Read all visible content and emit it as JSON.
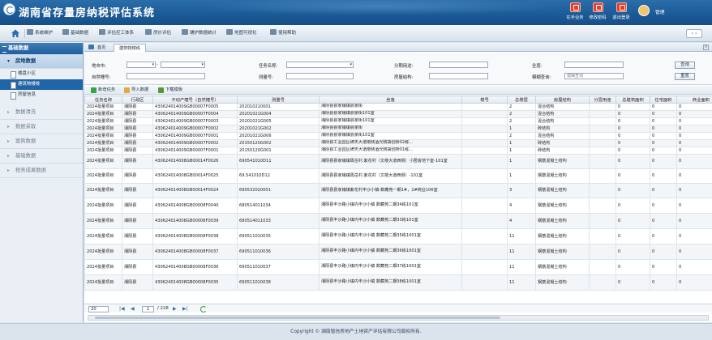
{
  "app": {
    "title": "湖南省存量房纳税评估系统"
  },
  "header": {
    "buttons": [
      {
        "label": "在手业务"
      },
      {
        "label": "修改密码"
      },
      {
        "label": "退出登录"
      }
    ],
    "username": "管理"
  },
  "nav": {
    "items": [
      {
        "label": "系统维护"
      },
      {
        "label": "基础数据"
      },
      {
        "label": "评估控工体系"
      },
      {
        "label": "房价评估"
      },
      {
        "label": "辅护数据统计"
      },
      {
        "label": "地图可视化"
      },
      {
        "label": "使用帮助"
      }
    ],
    "arrows": "‹ ›"
  },
  "sidebar": {
    "title": "基础数据",
    "sections": [
      {
        "label": "房地数据",
        "active": true,
        "items": [
          {
            "label": "楼盘小区"
          },
          {
            "label": "建筑物楼栋",
            "selected": true
          },
          {
            "label": "房屋信息"
          }
        ]
      },
      {
        "label": "数据清洗"
      },
      {
        "label": "数据采取"
      },
      {
        "label": "案例数据"
      },
      {
        "label": "基础数据"
      },
      {
        "label": "税务成果数据"
      }
    ]
  },
  "tabs": [
    {
      "label": "首页"
    },
    {
      "label": "建筑物楼栋"
    }
  ],
  "tab_close": "×",
  "search": {
    "labels": {
      "region": "地市市:",
      "dash": "-",
      "name": "任务名称:",
      "pattern": "分期用途:",
      "floor": "全层:",
      "natural_no": "自然幢号:",
      "survey_no": "测量号:",
      "structure": "房屋结构:",
      "fuzzy": "模糊查询:"
    },
    "fuzzy_placeholder": "模糊查询",
    "query_btn": "查询",
    "reset_btn": "重置"
  },
  "toolbar": {
    "add": "新增任务",
    "import": "导入数据",
    "download": "下载模板"
  },
  "table": {
    "headers": [
      "任务名称",
      "行政区",
      "不动产幢号（自然幢号）",
      "测量号",
      "坐落",
      "楼号",
      "总楼层",
      "房屋结构",
      "分层用途",
      "总建筑面积",
      "住宅面积",
      "商业面积"
    ],
    "rows": [
      [
        "2024批量项目",
        "湘阴县",
        "430624014009GB00007F0005",
        "202010210001",
        "湘阴县县家铺镇县家街",
        "",
        "2",
        "混合结构",
        "",
        "0",
        "0",
        "0"
      ],
      [
        "2024批量项目",
        "湘阴县",
        "430624014009GB00007F0004",
        "20201021G004",
        "湘阴县县家铺镇县家街101室",
        "",
        "2",
        "混合结构",
        "",
        "0",
        "0",
        "0"
      ],
      [
        "2024批量项目",
        "湘阴县",
        "430624014009GB00007F0003",
        "20201021G005",
        "湘阴县县家铺镇县家街101室",
        "",
        "2",
        "混合结构",
        "",
        "0",
        "0",
        "0"
      ],
      [
        "2024批量项目",
        "湘阴县",
        "430624014009GB00007F0002",
        "20201021G002",
        "湘阴县县家铺镇县家街",
        "",
        "1",
        "砖结构",
        "",
        "0",
        "0",
        "0"
      ],
      [
        "2024批量项目",
        "湘阴县",
        "430624014009GB00007F0001",
        "20201021G006",
        "湘阴县县家铺镇县家街101室",
        "",
        "2",
        "混合结构",
        "",
        "0",
        "0",
        "0"
      ],
      [
        "2024批量项目",
        "湘阴县",
        "430624014009GB00007F0002",
        "20150120G002",
        "湘阴县工业园区碑天大道南侧酒光锈袋创桥02栋...",
        "",
        "1",
        "砖结构",
        "",
        "0",
        "0",
        "0"
      ],
      [
        "2024批量项目",
        "湘阴县",
        "430624014009GB00007F0001",
        "20150120G001",
        "湘阴县工业园区碑天大道南侧酒光锈袋创桥01栋...",
        "",
        "1",
        "砖结构",
        "",
        "0",
        "0",
        "0"
      ],
      [
        "2024批量项目",
        "湘阴县",
        "430624014008GB00014F0026",
        "690541010D11",
        "湘阴县县家铺镇周岳村.紫花村（文楼大道西侧）小居房地下室-101室",
        "",
        "1",
        "钢筋混凝土结构",
        "",
        "0",
        "0",
        "0"
      ],
      [
        "2024批量项目",
        "湘阴县",
        "430624014008GB00014F0025",
        "69.541010D12",
        "湘阴县县家铺镇周岳村.紫花村（文楼大道西侧）-101室",
        "",
        "1",
        "钢筋混凝土结构",
        "",
        "0",
        "0",
        "0"
      ],
      [
        "2024批量项目",
        "湘阴县",
        "430624014008GB00014F0024",
        "690532020001",
        "湘阴县县家铺镇紫花村丰沙小镇-数藏苑一期1#，2#商业106室",
        "",
        "3",
        "钢筋混凝土结构",
        "",
        "0",
        "0",
        "0"
      ],
      [
        "2024批量项目",
        "湘阴县",
        "430624014008GB00008F0040",
        "680514011034",
        "湘阴县丰沙路小镇内丰沙小镇 数藏苑二期34栋101室",
        "",
        "4",
        "钢筋混凝土结构",
        "",
        "0",
        "0",
        "0"
      ],
      [
        "2024批量项目",
        "湘阴县",
        "430624014008GB00008F0039",
        "680514011033",
        "湘阴县丰沙路小镇内丰沙小镇 数藏苑二期33栋101室",
        "",
        "4",
        "钢筋混凝土结构",
        "",
        "0",
        "0",
        "0"
      ],
      [
        "2024批量项目",
        "湘阴县",
        "430624014008GB00008F0038",
        "690511010035",
        "湘阴县丰沙路小镇内丰沙小镇 数藏苑二期35栋1001室",
        "",
        "11",
        "钢筋混凝土结构",
        "",
        "0",
        "0",
        "0"
      ],
      [
        "2024批量项目",
        "湘阴县",
        "430624014008GB00008F0037",
        "690511010036",
        "湘阴县丰沙路小镇内丰沙小镇 数藏苑二期36栋1001室",
        "",
        "11",
        "钢筋混凝土结构",
        "",
        "0",
        "0",
        "0"
      ],
      [
        "2024批量项目",
        "湘阴县",
        "430624014008GB00008F0036",
        "690511010037",
        "湘阴县丰沙路小镇内丰沙小镇 数藏苑二期37栋1001室",
        "",
        "11",
        "钢筋混凝土结构",
        "",
        "0",
        "0",
        "0"
      ],
      [
        "2024批量项目",
        "湘阴县",
        "430624014008GB00008F0035",
        "690511010038",
        "湘阴县丰沙路小镇内丰沙小镇 数藏苑二期38栋1001室",
        "",
        "11",
        "钢筋混凝土结构",
        "",
        "0",
        "0",
        "0"
      ]
    ]
  },
  "pager": {
    "page_size": "20",
    "current": "1",
    "total": "/ 228"
  },
  "footer": {
    "copyright": "Copyright © 湖南智信房地产土地资产评估有限公司版权所有."
  },
  "colors": {
    "header": "#1c5b98",
    "selected": "#1f64a6",
    "accent_red": "#e1402f"
  }
}
